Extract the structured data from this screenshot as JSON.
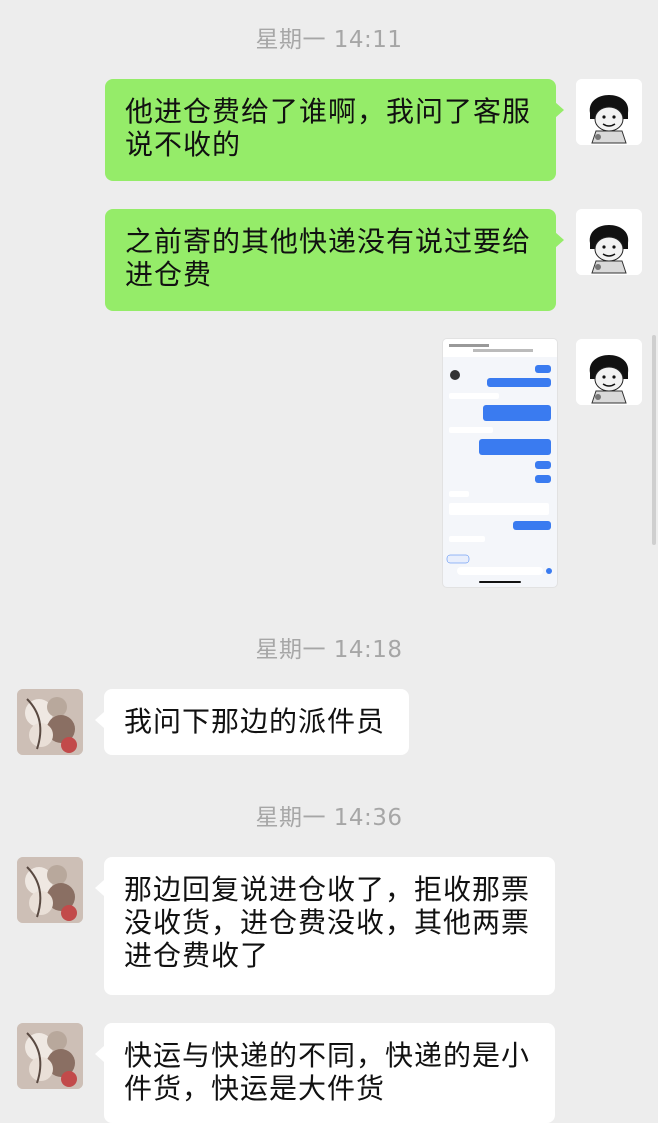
{
  "timestamps": [
    "星期一 14:11",
    "星期一 14:18",
    "星期一 14:36"
  ],
  "messages": [
    {
      "side": "me",
      "text_lines": [
        "他进仓费给了谁啊，我问了客服",
        "说不收的"
      ]
    },
    {
      "side": "me",
      "text_lines": [
        "之前寄的其他快递没有说过要给",
        "进仓费"
      ]
    },
    {
      "side": "me",
      "type": "image",
      "image_desc_icon": "chat-screenshot-thumbnail"
    },
    {
      "side": "other",
      "text_lines": [
        "我问下那边的派件员"
      ]
    },
    {
      "side": "other",
      "text_lines": [
        "那边回复说进仓收了，拒收那票",
        "没收货，进仓费没收，其他两票",
        "进仓费收了"
      ]
    },
    {
      "side": "other",
      "text_lines": [
        "快运与快递的不同，快递的是小",
        "件货，快运是大件货"
      ]
    }
  ],
  "colors": {
    "background": "#ededed",
    "my_bubble": "#95ec69",
    "their_bubble": "#ffffff",
    "timestamp": "#a6a6a6"
  },
  "icons": {
    "my_avatar": "meme-cartoon-face-avatar",
    "their_avatar": "floral-art-avatar"
  }
}
